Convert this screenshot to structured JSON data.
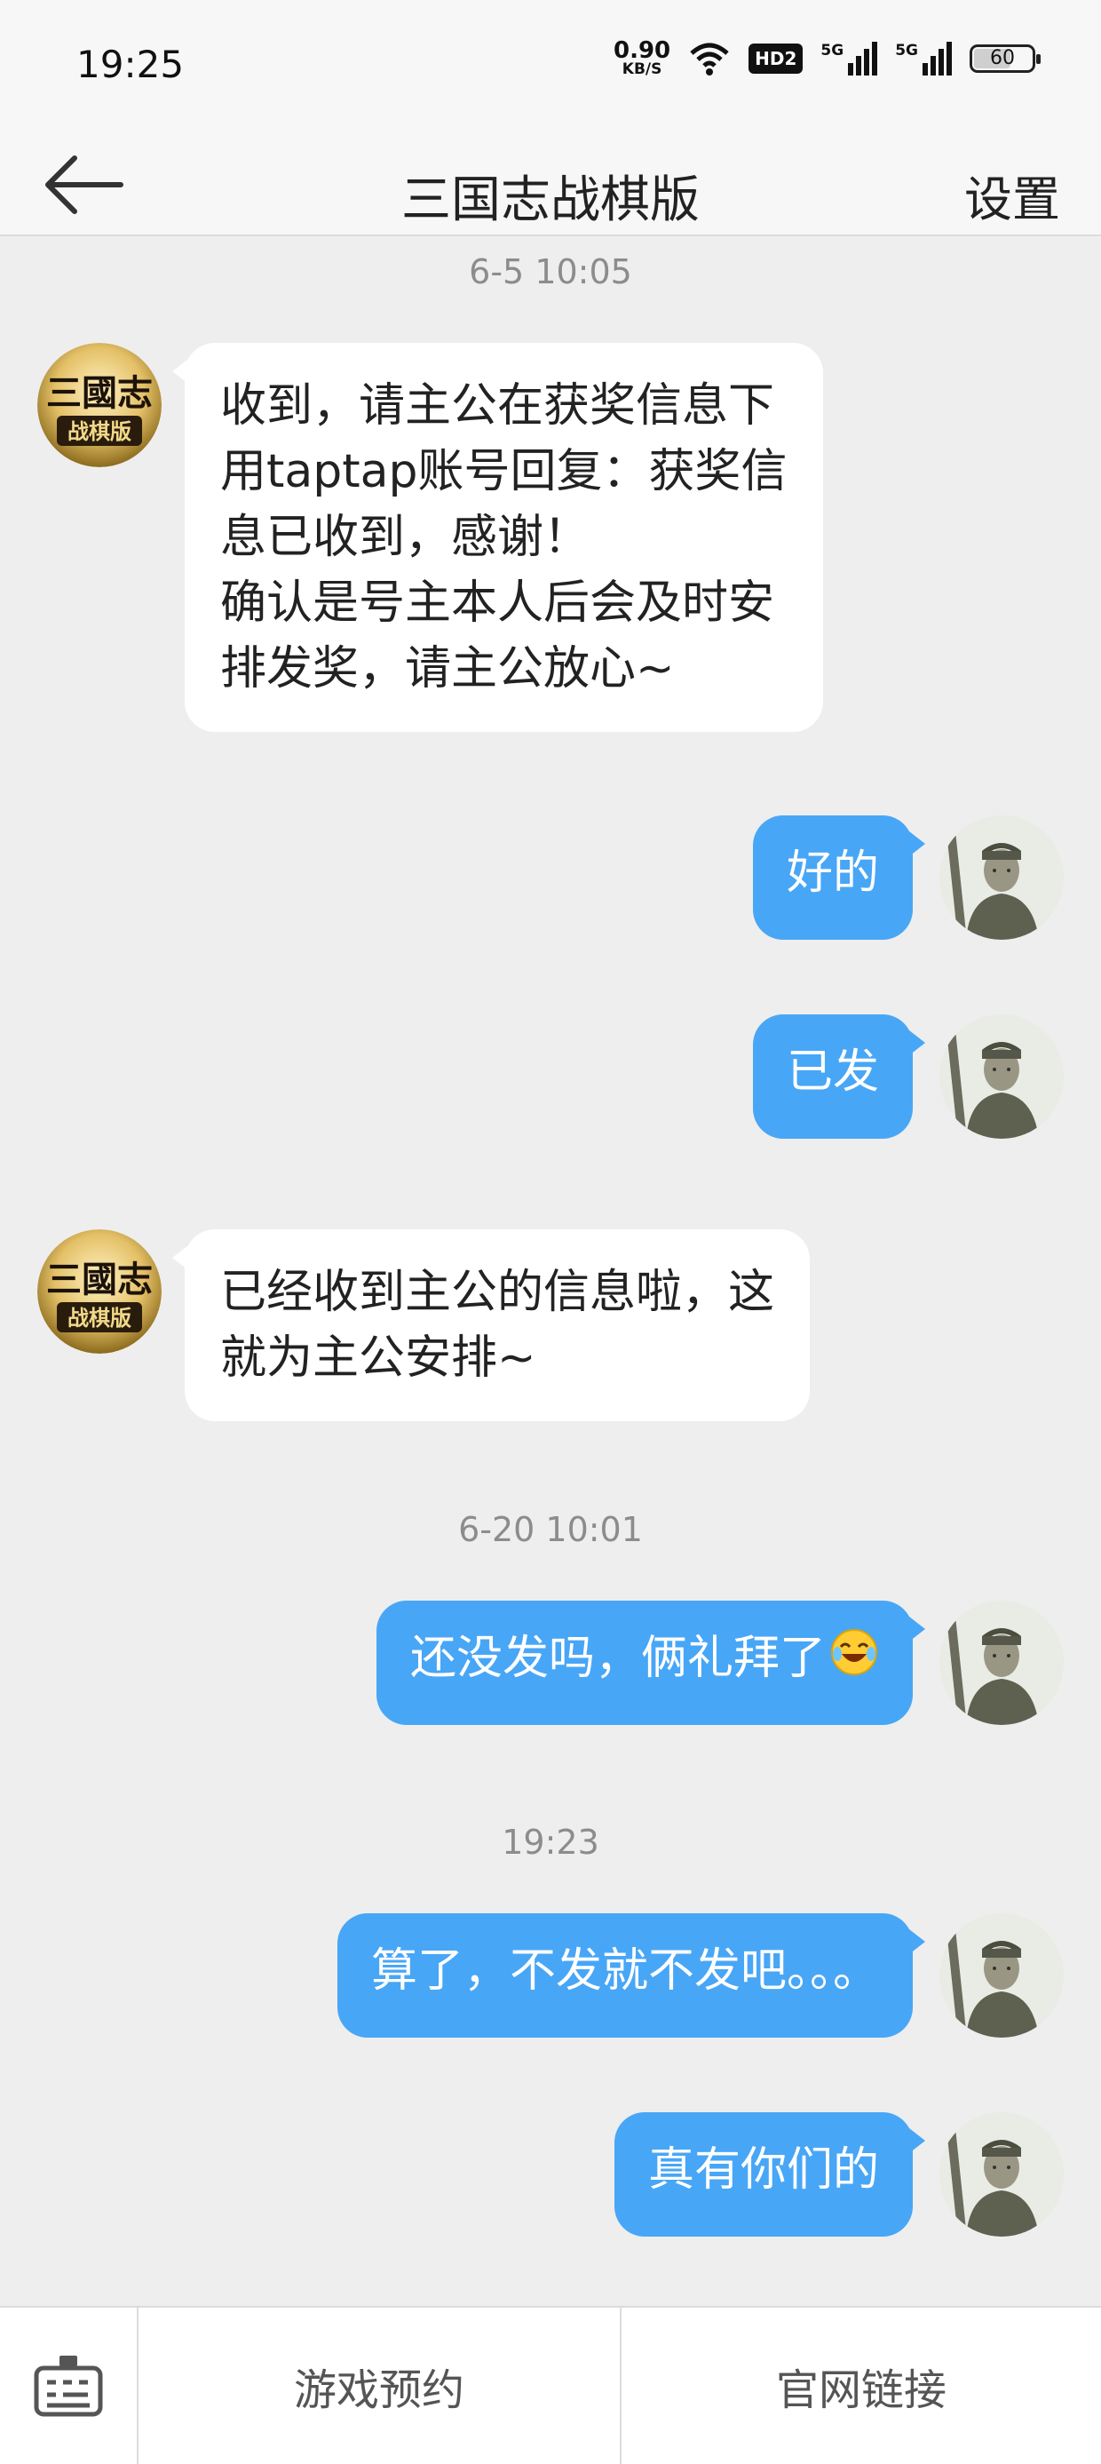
{
  "status_bar": {
    "time": "19:25",
    "net_speed_value": "0.90",
    "net_speed_unit": "KB/S",
    "hd_badge": "HD2",
    "signal_1_label": "5G",
    "signal_2_label": "5G",
    "battery_level": "60"
  },
  "header": {
    "back_icon": "arrow-left-icon",
    "title": "三国志战棋版",
    "settings_label": "设置"
  },
  "bot": {
    "avatar_text_top": "三國志",
    "avatar_text_bottom": "战棋版"
  },
  "messages": {
    "ts1": "6-5 10:05",
    "m1": {
      "l1": "收到，请主公在获奖信息下",
      "l2": "用taptap账号回复：获奖信",
      "l3": "息已收到，感谢！",
      "l4": "确认是号主本人后会及时安",
      "l5": "排发奖，请主公放心~"
    },
    "m2": "好的",
    "m3": "已发",
    "m4": {
      "l1": "已经收到主公的信息啦，这",
      "l2": "就为主公安排~"
    },
    "ts2": "6-20 10:01",
    "m5": "还没发吗，俩礼拜了",
    "ts3": "19:23",
    "m6": "算了，不发就不发吧。。。",
    "m7": "真有你们的"
  },
  "bottom_bar": {
    "keyboard_icon": "keyboard-icon",
    "menu_1": "游戏预约",
    "menu_2": "官网链接"
  },
  "colors": {
    "outgoing_bubble": "#48a6f6",
    "incoming_bubble": "#ffffff",
    "background": "#eeeeee"
  }
}
